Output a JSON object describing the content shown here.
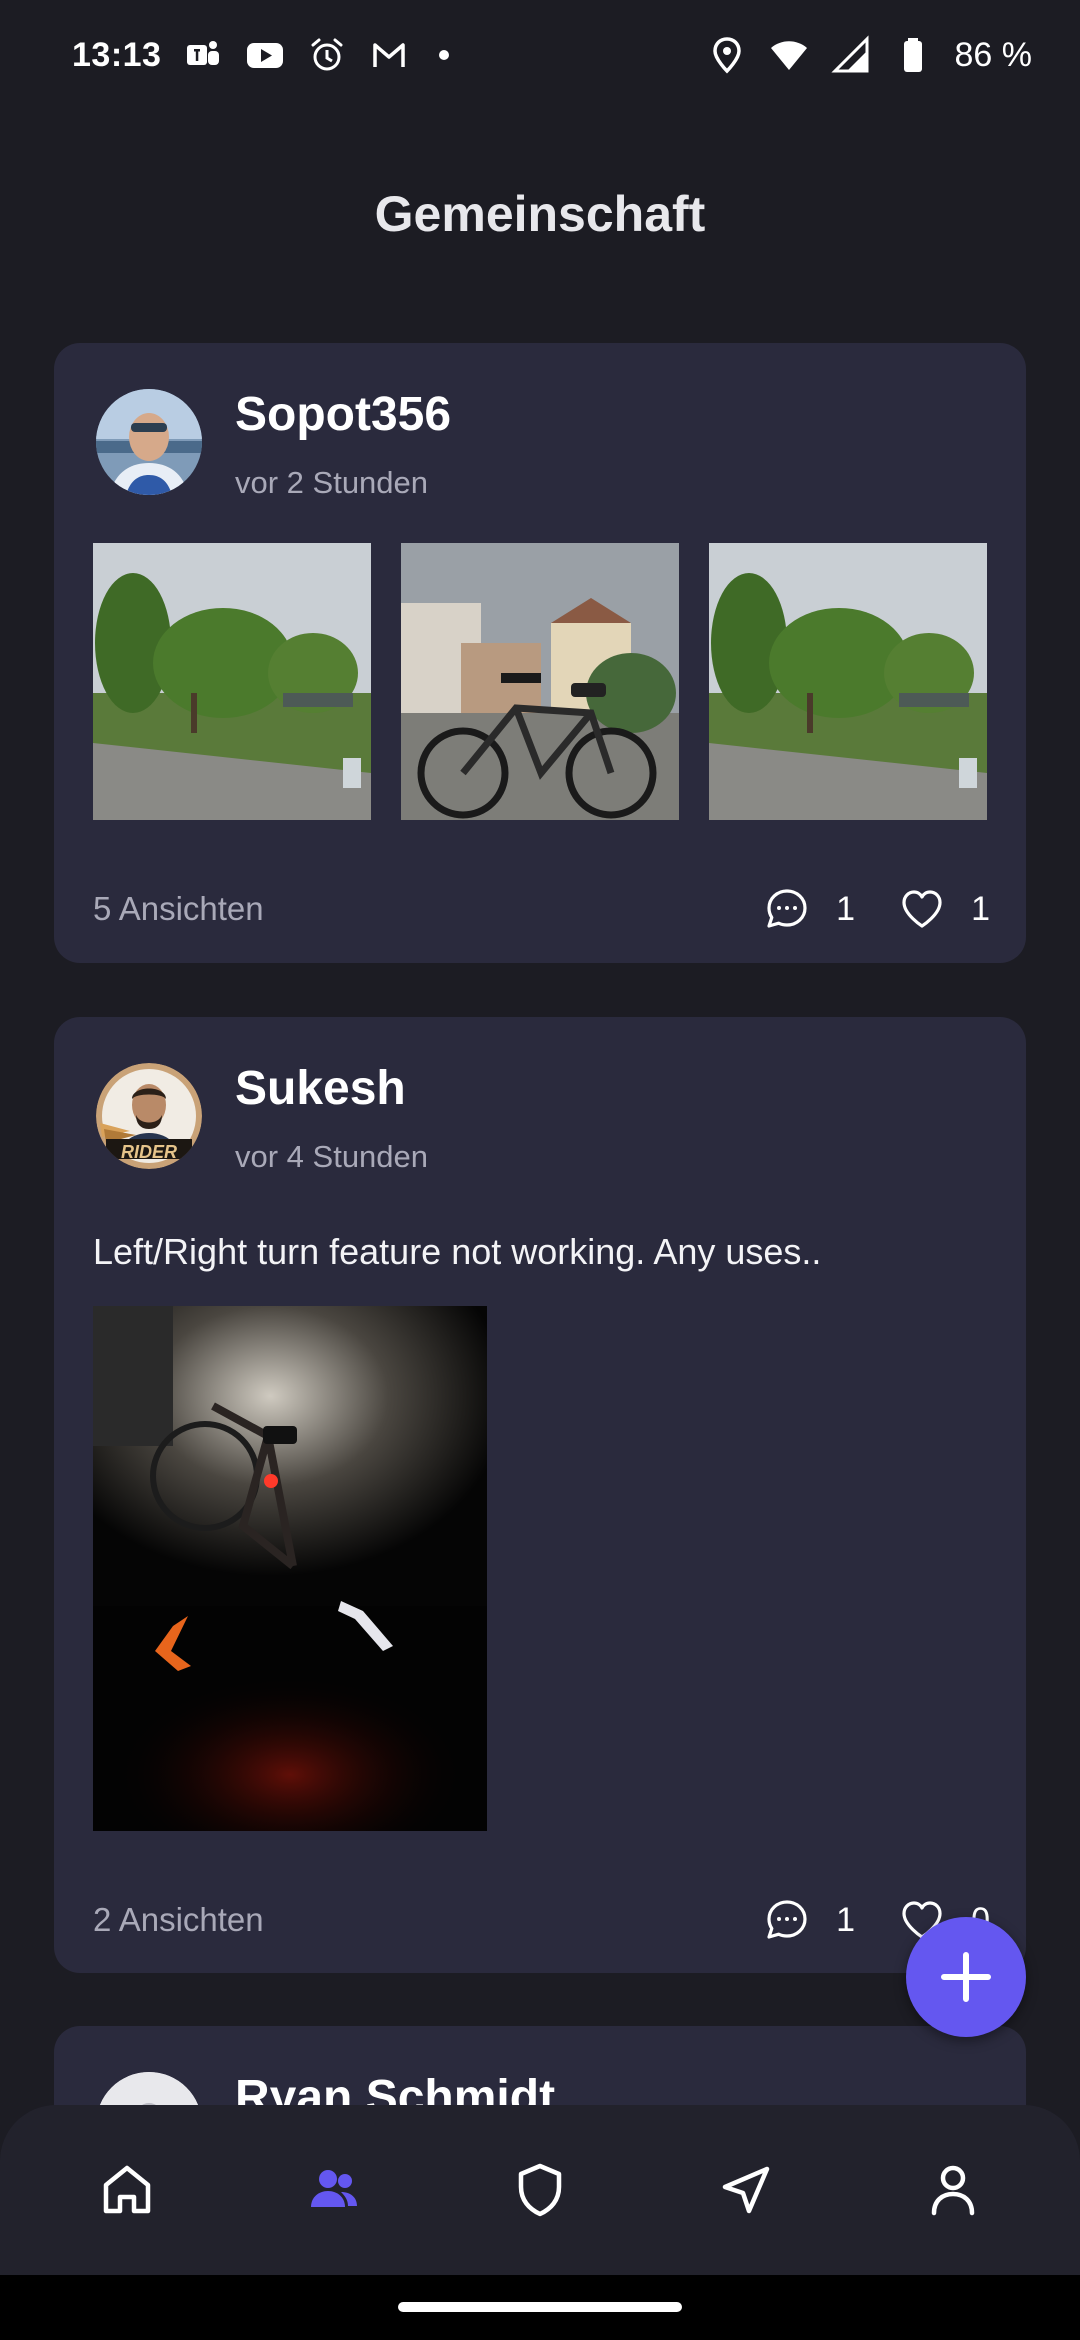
{
  "status_bar": {
    "time": "13:13",
    "battery": "86 %",
    "left_icons": [
      "teams-icon",
      "youtube-icon",
      "alarm-icon",
      "gmail-icon"
    ],
    "right_icons": [
      "location-icon",
      "wifi-icon",
      "signal-icon",
      "battery-icon"
    ]
  },
  "page": {
    "title": "Gemeinschaft"
  },
  "posts": [
    {
      "author": "Sopot356",
      "time": "vor 2 Stunden",
      "text": "",
      "views": "5 Ansichten",
      "comments": "1",
      "likes": "1",
      "photos": [
        "park-photo",
        "bicycle-photo",
        "park-photo"
      ]
    },
    {
      "author": "Sukesh",
      "avatar_badge": "RIDER",
      "time": "vor 4 Stunden",
      "text": "Left/Right turn feature not working. Any uses..",
      "views": "2 Ansichten",
      "comments": "1",
      "likes": "0",
      "photos": [
        "night-bicycle-photo"
      ]
    },
    {
      "author": "Ryan Schmidt"
    }
  ],
  "bottom_nav": [
    "home-icon",
    "community-icon",
    "shield-icon",
    "navigation-icon",
    "profile-icon"
  ],
  "colors": {
    "background": "#1c1c23",
    "card": "#2a2a3d",
    "accent": "#6457f0",
    "muted_text": "#a9a9b8"
  }
}
